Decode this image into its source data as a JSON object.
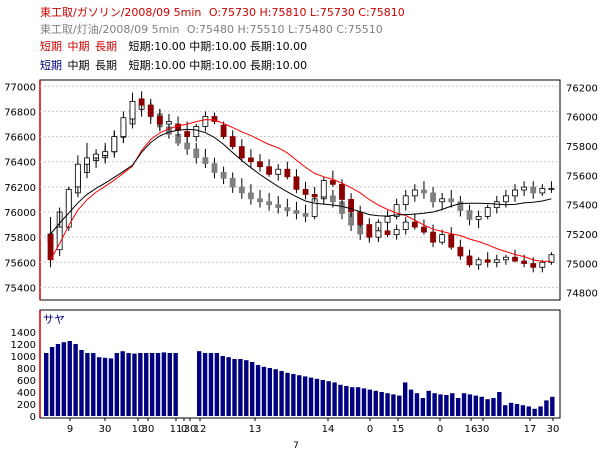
{
  "header": {
    "line1": {
      "name": "東工取/ガソリン/2008/09 5min",
      "ohlc": "O:75730 H:75810 L:75730 C:75810",
      "color": "#cc0000"
    },
    "line2": {
      "name": "東工取/灯油/2008/09  5min",
      "ohlc": "O:75480 H:75510 L:75480 C:75510",
      "color": "#808080"
    },
    "ma_line_red": {
      "labels": [
        "短期",
        "中期",
        "長期"
      ],
      "values": "短期:10.00 中期:10.00 長期:10.00",
      "label_color": "#cc0000"
    },
    "ma_line_blue": {
      "labels": [
        "短期",
        "中期",
        "長期"
      ],
      "values": "短期:10.00 中期:10.00 長期:10.00",
      "label_color": "#000080"
    }
  },
  "colors": {
    "gasoline_up": "#ffffff",
    "gasoline_down": "#8b0000",
    "kerosene_up": "#ffffff",
    "kerosene_down": "#808080",
    "ma_gasoline": "#ff0000",
    "ma_kerosene": "#000000",
    "volume_bar": "#000080",
    "frame_left": "#cc0000"
  },
  "volume_panel": {
    "title": "サヤ",
    "yticks": [
      "1400",
      "1200",
      "1000",
      "800",
      "600",
      "400",
      "200",
      "0"
    ]
  },
  "chart_data": {
    "type": "candlestick",
    "left_axis": {
      "ticks": [
        77000,
        76800,
        76600,
        76400,
        76200,
        76000,
        75800,
        75600,
        75400
      ],
      "ylim": [
        75300,
        77050
      ]
    },
    "right_axis": {
      "ticks": [
        76200,
        76000,
        75800,
        75600,
        75400,
        75200,
        75000,
        74800
      ],
      "ylim": [
        74750,
        76250
      ]
    },
    "x_ticks": [
      "9",
      "30",
      "10",
      "30",
      "11",
      "0",
      "30",
      "12",
      "13",
      "14",
      "0",
      "15",
      "0",
      "16",
      "30",
      "17",
      "30"
    ],
    "x_sub_label": "7",
    "gasoline_candles": [
      [
        75820,
        75960,
        75560,
        75620
      ],
      [
        75700,
        76000,
        75650,
        75880
      ],
      [
        75880,
        76200,
        75850,
        76180
      ],
      [
        76200,
        76450,
        76150,
        76380
      ],
      [
        76380,
        76550,
        76300,
        76430
      ],
      [
        76430,
        76500,
        76380,
        76460
      ],
      [
        76450,
        76550,
        76400,
        76480
      ],
      [
        76480,
        76650,
        76450,
        76600
      ],
      [
        76600,
        76800,
        76550,
        76750
      ],
      [
        76740,
        76950,
        76700,
        76880
      ],
      [
        76900,
        76960,
        76800,
        76850
      ],
      [
        76850,
        76900,
        76700,
        76760
      ],
      [
        76760,
        76820,
        76650,
        76700
      ],
      [
        76700,
        76780,
        76650,
        76720
      ],
      [
        76700,
        76760,
        76600,
        76650
      ],
      [
        76640,
        76720,
        76550,
        76600
      ],
      [
        76600,
        76700,
        76560,
        76680
      ],
      [
        76680,
        76800,
        76640,
        76760
      ],
      [
        76760,
        76790,
        76700,
        76720
      ],
      [
        76690,
        76720,
        76580,
        76600
      ],
      [
        76600,
        76650,
        76500,
        76520
      ],
      [
        76520,
        76580,
        76400,
        76430
      ],
      [
        76430,
        76500,
        76350,
        76400
      ],
      [
        76400,
        76460,
        76320,
        76360
      ],
      [
        76360,
        76420,
        76280,
        76300
      ],
      [
        76300,
        76380,
        76250,
        76340
      ],
      [
        76340,
        76400,
        76260,
        76280
      ],
      [
        76280,
        76340,
        76150,
        76180
      ],
      [
        76180,
        76240,
        76100,
        76140
      ],
      [
        76140,
        76200,
        76080,
        76120
      ],
      [
        76120,
        76280,
        76100,
        76250
      ],
      [
        76250,
        76330,
        76200,
        76220
      ],
      [
        76220,
        76260,
        76060,
        76100
      ],
      [
        76100,
        76150,
        75960,
        76000
      ],
      [
        76000,
        76050,
        75880,
        75900
      ],
      [
        75900,
        75950,
        75780,
        75800
      ],
      [
        75800,
        75880,
        75760,
        75850
      ],
      [
        75850,
        75920,
        75800,
        75820
      ],
      [
        75820,
        75900,
        75780,
        75860
      ],
      [
        75860,
        75960,
        75820,
        75920
      ],
      [
        75920,
        75990,
        75860,
        75880
      ],
      [
        75880,
        75940,
        75820,
        75840
      ],
      [
        75840,
        75900,
        75720,
        75760
      ],
      [
        75760,
        75860,
        75740,
        75820
      ],
      [
        75820,
        75880,
        75700,
        75720
      ],
      [
        75720,
        75780,
        75620,
        75650
      ],
      [
        75650,
        75700,
        75560,
        75580
      ],
      [
        75580,
        75640,
        75540,
        75620
      ],
      [
        75620,
        75680,
        75560,
        75600
      ],
      [
        75600,
        75660,
        75560,
        75620
      ],
      [
        75620,
        75660,
        75580,
        75640
      ],
      [
        75640,
        75700,
        75600,
        75610
      ],
      [
        75610,
        75660,
        75560,
        75590
      ],
      [
        75590,
        75640,
        75520,
        75560
      ],
      [
        75560,
        75620,
        75520,
        75600
      ],
      [
        75600,
        75680,
        75580,
        75660
      ]
    ],
    "kerosene_candles": [
      [
        75150,
        75250,
        75050,
        75200
      ],
      [
        75200,
        75380,
        75150,
        75350
      ],
      [
        75350,
        75520,
        75300,
        75480
      ],
      [
        75480,
        75650,
        75450,
        75620
      ],
      [
        75620,
        75750,
        75580,
        75700
      ],
      [
        75700,
        75760,
        75650,
        75720
      ],
      [
        75720,
        75800,
        75680,
        75760
      ],
      [
        75760,
        75900,
        75720,
        75860
      ],
      [
        75860,
        75980,
        75820,
        75950
      ],
      [
        75950,
        76080,
        75920,
        76050
      ],
      [
        76050,
        76120,
        76000,
        76080
      ],
      [
        76080,
        76100,
        75980,
        76020
      ],
      [
        76020,
        76050,
        75900,
        75930
      ],
      [
        75930,
        75980,
        75850,
        75880
      ],
      [
        75880,
        75940,
        75800,
        75820
      ],
      [
        75820,
        75880,
        75740,
        75780
      ],
      [
        75780,
        75820,
        75680,
        75720
      ],
      [
        75720,
        75780,
        75650,
        75680
      ],
      [
        75680,
        75720,
        75580,
        75620
      ],
      [
        75620,
        75660,
        75540,
        75580
      ],
      [
        75580,
        75620,
        75480,
        75520
      ],
      [
        75520,
        75580,
        75440,
        75480
      ],
      [
        75480,
        75540,
        75400,
        75440
      ],
      [
        75440,
        75500,
        75380,
        75420
      ],
      [
        75420,
        75480,
        75360,
        75400
      ],
      [
        75400,
        75460,
        75340,
        75380
      ],
      [
        75380,
        75440,
        75320,
        75360
      ],
      [
        75360,
        75420,
        75300,
        75340
      ],
      [
        75340,
        75400,
        75280,
        75320
      ],
      [
        75320,
        75460,
        75300,
        75440
      ],
      [
        75440,
        75500,
        75400,
        75460
      ],
      [
        75460,
        75500,
        75380,
        75420
      ],
      [
        75420,
        75460,
        75300,
        75340
      ],
      [
        75340,
        75380,
        75220,
        75260
      ],
      [
        75260,
        75300,
        75160,
        75200
      ],
      [
        75200,
        75260,
        75140,
        75180
      ],
      [
        75180,
        75300,
        75160,
        75280
      ],
      [
        75280,
        75360,
        75240,
        75320
      ],
      [
        75320,
        75440,
        75300,
        75400
      ],
      [
        75400,
        75500,
        75360,
        75460
      ],
      [
        75460,
        75540,
        75420,
        75500
      ],
      [
        75500,
        75560,
        75440,
        75480
      ],
      [
        75480,
        75520,
        75380,
        75420
      ],
      [
        75420,
        75480,
        75360,
        75440
      ],
      [
        75440,
        75500,
        75380,
        75420
      ],
      [
        75420,
        75460,
        75320,
        75360
      ],
      [
        75360,
        75400,
        75260,
        75300
      ],
      [
        75300,
        75360,
        75240,
        75320
      ],
      [
        75320,
        75400,
        75300,
        75380
      ],
      [
        75380,
        75460,
        75340,
        75420
      ],
      [
        75420,
        75500,
        75380,
        75460
      ],
      [
        75460,
        75540,
        75420,
        75500
      ],
      [
        75500,
        75560,
        75460,
        75520
      ],
      [
        75520,
        75560,
        75440,
        75480
      ],
      [
        75480,
        75540,
        75460,
        75510
      ],
      [
        75510,
        75560,
        75480,
        75510
      ]
    ],
    "volume": [
      1050,
      1150,
      1200,
      1230,
      1250,
      1200,
      1100,
      1050,
      1050,
      980,
      970,
      960,
      1050,
      1080,
      1050,
      1040,
      1050,
      1050,
      1050,
      1050,
      1060,
      1050,
      1050,
      null,
      null,
      null,
      1080,
      1050,
      1050,
      1050,
      1000,
      980,
      950,
      950,
      930,
      900,
      850,
      820,
      800,
      780,
      750,
      720,
      700,
      680,
      660,
      640,
      620,
      600,
      580,
      560,
      520,
      500,
      480,
      480,
      460,
      440,
      420,
      400,
      380,
      360,
      340,
      560,
      440,
      380,
      300,
      420,
      380,
      360,
      350,
      380,
      300,
      380,
      360,
      340,
      320,
      280,
      300,
      400,
      180,
      220,
      200,
      180,
      160,
      120,
      160,
      260,
      320
    ]
  }
}
